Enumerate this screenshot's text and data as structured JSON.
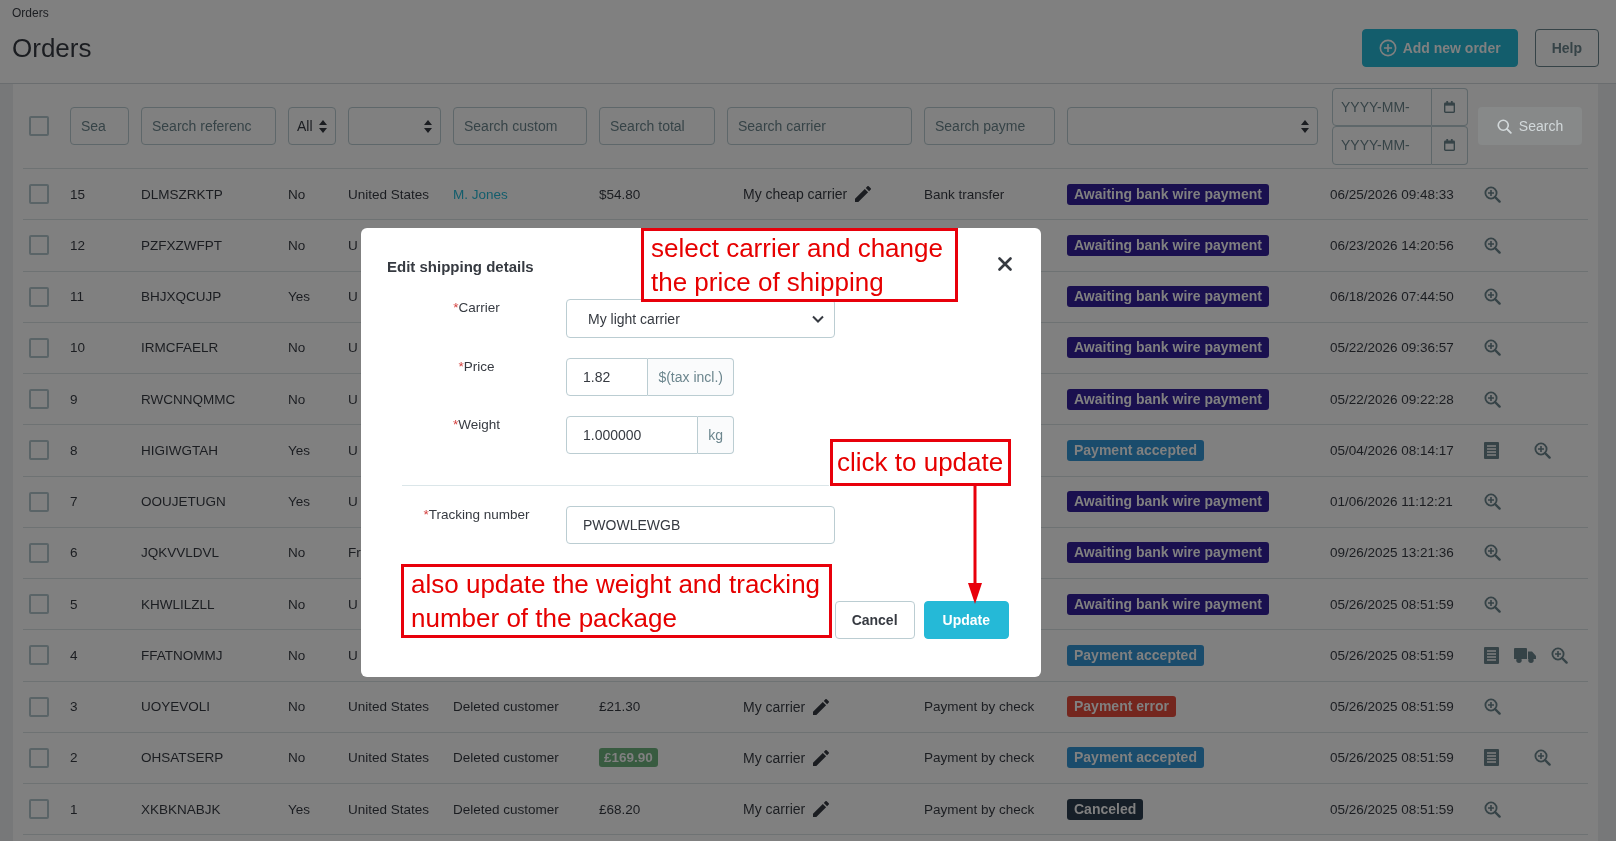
{
  "breadcrumb": "Orders",
  "page_title": "Orders",
  "header_buttons": [
    {
      "kind": "add",
      "label": "Add new order"
    },
    {
      "kind": "help",
      "label": "Help"
    }
  ],
  "filters": {
    "select_all": {
      "checked": false
    },
    "fields": [
      {
        "kind": "text",
        "placeholder": "Sea"
      },
      {
        "kind": "text",
        "placeholder": "Search referenc"
      },
      {
        "kind": "select",
        "value": "All"
      },
      {
        "kind": "select"
      },
      {
        "kind": "text",
        "placeholder": "Search custom"
      },
      {
        "kind": "text",
        "placeholder": "Search total"
      },
      {
        "kind": "text",
        "placeholder": "Search carrier"
      },
      {
        "kind": "text",
        "placeholder": "Search payme"
      },
      {
        "kind": "select"
      },
      {
        "kind": "date_range",
        "from_placeholder": "YYYY-MM-",
        "to_placeholder": "YYYY-MM-"
      }
    ],
    "search_button": {
      "label": "Search",
      "disabled": true
    }
  },
  "rows": [
    {
      "checked": false,
      "id": "15",
      "reference": "DLMSZRKTP",
      "new_client": "No",
      "country": "United States",
      "customer": {
        "text": "M. Jones",
        "link": true
      },
      "total": {
        "text": "$54.80",
        "highlighted": false
      },
      "carrier": "My cheap carrier",
      "payment": "Bank transfer",
      "status": {
        "text": "Awaiting bank wire payment",
        "color": "#1a104f"
      },
      "date": "06/25/2026 09:48:33",
      "actions": [
        {
          "kind": "view"
        }
      ]
    },
    {
      "checked": false,
      "id": "12",
      "reference": "PZFXZWFPT",
      "new_client": "No",
      "country": "U",
      "status": {
        "text": "Awaiting bank wire payment",
        "color": "#1a104f"
      },
      "date": "06/23/2026 14:20:56",
      "actions": [
        {
          "kind": "view"
        }
      ]
    },
    {
      "checked": false,
      "id": "11",
      "reference": "BHJXQCUJP",
      "new_client": "Yes",
      "country": "U",
      "status": {
        "text": "Awaiting bank wire payment",
        "color": "#1a104f"
      },
      "date": "06/18/2026 07:44:50",
      "actions": [
        {
          "kind": "view"
        }
      ]
    },
    {
      "checked": false,
      "id": "10",
      "reference": "IRMCFAELR",
      "new_client": "No",
      "country": "U",
      "status": {
        "text": "Awaiting bank wire payment",
        "color": "#1a104f"
      },
      "date": "05/22/2026 09:36:57",
      "actions": [
        {
          "kind": "view"
        }
      ]
    },
    {
      "checked": false,
      "id": "9",
      "reference": "RWCNNQMMC",
      "new_client": "No",
      "country": "U",
      "status": {
        "text": "Awaiting bank wire payment",
        "color": "#1a104f"
      },
      "date": "05/22/2026 09:22:28",
      "actions": [
        {
          "kind": "view"
        }
      ]
    },
    {
      "checked": false,
      "id": "8",
      "reference": "HIGIWGTAH",
      "new_client": "Yes",
      "country": "U",
      "status": {
        "text": "Payment accepted",
        "color": "#1a4c6c"
      },
      "date": "05/04/2026 08:14:17",
      "actions": [
        {
          "kind": "invoice"
        },
        {
          "kind": "view"
        }
      ]
    },
    {
      "checked": false,
      "id": "7",
      "reference": "OOUJETUGN",
      "new_client": "Yes",
      "country": "U",
      "status": {
        "text": "Awaiting bank wire payment",
        "color": "#1a104f"
      },
      "date": "01/06/2026 11:12:21",
      "actions": [
        {
          "kind": "view"
        }
      ]
    },
    {
      "checked": false,
      "id": "6",
      "reference": "JQKVVLDVL",
      "new_client": "No",
      "country": "Fr",
      "status": {
        "text": "Awaiting bank wire payment",
        "color": "#1a104f"
      },
      "date": "09/26/2025 13:21:36",
      "actions": [
        {
          "kind": "view"
        }
      ]
    },
    {
      "checked": false,
      "id": "5",
      "reference": "KHWLILZLL",
      "new_client": "No",
      "country": "U",
      "status": {
        "text": "Awaiting bank wire payment",
        "color": "#1a104f"
      },
      "date": "05/26/2025 08:51:59",
      "actions": [
        {
          "kind": "view"
        }
      ]
    },
    {
      "checked": false,
      "id": "4",
      "reference": "FFATNOMMJ",
      "new_client": "No",
      "country": "U",
      "status": {
        "text": "Payment accepted",
        "color": "#1a4c6c"
      },
      "date": "05/26/2025 08:51:59",
      "actions": [
        {
          "kind": "invoice"
        },
        {
          "kind": "delivery"
        },
        {
          "kind": "view"
        }
      ]
    },
    {
      "checked": false,
      "id": "3",
      "reference": "UOYEVOLI",
      "new_client": "No",
      "country": "United States",
      "customer": {
        "text": "Deleted customer",
        "link": false
      },
      "total": {
        "text": "£21.30",
        "highlighted": false
      },
      "carrier": "My carrier",
      "payment": "Payment by check",
      "status": {
        "text": "Payment error",
        "color": "#74261e"
      },
      "date": "05/26/2025 08:51:59",
      "actions": [
        {
          "kind": "view"
        }
      ]
    },
    {
      "checked": false,
      "id": "2",
      "reference": "OHSATSERP",
      "new_client": "No",
      "country": "United States",
      "customer": {
        "text": "Deleted customer",
        "link": false
      },
      "total": {
        "text": "£169.90",
        "highlighted": true
      },
      "carrier": "My carrier",
      "payment": "Payment by check",
      "status": {
        "text": "Payment accepted",
        "color": "#1a4c6c"
      },
      "date": "05/26/2025 08:51:59",
      "actions": [
        {
          "kind": "invoice"
        },
        {
          "kind": "view"
        }
      ]
    },
    {
      "checked": false,
      "id": "1",
      "reference": "XKBKNABJK",
      "new_client": "Yes",
      "country": "United States",
      "customer": {
        "text": "Deleted customer",
        "link": false
      },
      "total": {
        "text": "£68.20",
        "highlighted": false
      },
      "carrier": "My carrier",
      "payment": "Payment by check",
      "status": {
        "text": "Canceled",
        "color": "#161f28"
      },
      "date": "05/26/2025 08:51:59",
      "actions": [
        {
          "kind": "view"
        }
      ]
    }
  ],
  "modal": {
    "title": "Edit shipping details",
    "sections": [
      {
        "fields": [
          {
            "kind": "select",
            "required_mark": "*",
            "label": "Carrier",
            "value": "My light carrier"
          },
          {
            "kind": "input_addon",
            "required_mark": "*",
            "label": "Price",
            "value": "1.82",
            "addon": "$(tax incl.)"
          },
          {
            "kind": "input_addon",
            "required_mark": "*",
            "label": "Weight",
            "value": "1.000000",
            "addon": "kg"
          }
        ]
      },
      {
        "fields": [
          {
            "kind": "input",
            "required_mark": "*",
            "label": "Tracking number",
            "value": "PWOWLEWGB"
          }
        ]
      }
    ],
    "buttons": [
      {
        "kind": "secondary",
        "label": "Cancel"
      },
      {
        "kind": "primary",
        "label": "Update"
      }
    ]
  },
  "annotations": [
    {
      "text": "select carrier and change\nthe price of shipping"
    },
    {
      "text": "click to update",
      "arrow": true
    },
    {
      "text": "also update the weight and tracking\nnumber of the package"
    }
  ]
}
